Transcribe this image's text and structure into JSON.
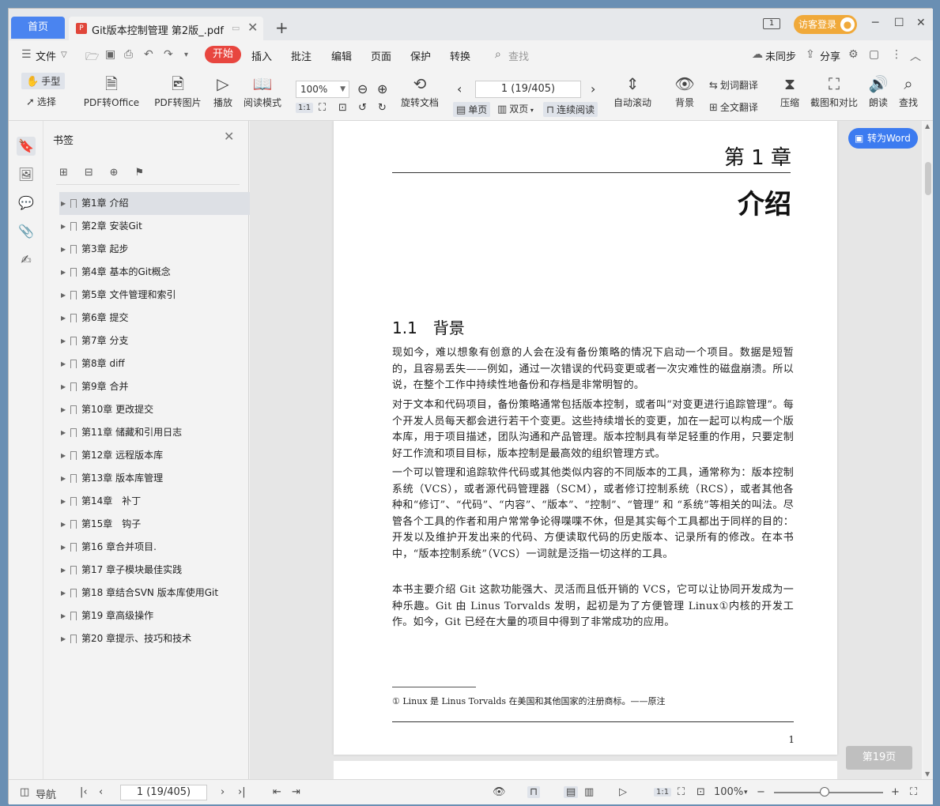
{
  "tabs": {
    "home": "首页",
    "doc_title": "Git版本控制管理 第2版_.pdf",
    "add": "+"
  },
  "titlebar": {
    "page_count_badge": "1",
    "login": "访客登录"
  },
  "menubar": {
    "file": "文件",
    "start": "开始",
    "insert": "插入",
    "annotate": "批注",
    "edit": "编辑",
    "page": "页面",
    "protect": "保护",
    "convert": "转换",
    "search_placeholder": "查找",
    "sync": "未同步",
    "share": "分享"
  },
  "ribbon": {
    "hand": "手型",
    "select": "选择",
    "pdf_to_office": "PDF转Office",
    "pdf_to_image": "PDF转图片",
    "play": "播放",
    "read_mode": "阅读模式",
    "zoom": "100%",
    "rotate_doc": "旋转文档",
    "page_indicator": "1 (19/405)",
    "single_page": "单页",
    "double_page": "双页",
    "continuous": "连续阅读",
    "auto_scroll": "自动滚动",
    "background": "背景",
    "word_translate": "划词翻译",
    "full_translate": "全文翻译",
    "compress": "压缩",
    "screenshot_compare": "截图和对比",
    "read_aloud": "朗读",
    "find": "查找"
  },
  "bookmarks": {
    "title": "书签",
    "items": [
      "第1章 介绍",
      "第2章 安装Git",
      "第3章 起步",
      "第4章 基本的Git概念",
      "第5章 文件管理和索引",
      "第6章 提交",
      "第7章 分支",
      "第8章 diff",
      "第9章 合并",
      "第10章 更改提交",
      "第11章 储藏和引用日志",
      "第12章 远程版本库",
      "第13章 版本库管理",
      "第14章　补丁",
      "第15章　钩子",
      "第16 章合并项目.",
      "第17 章子模块最佳实践",
      "第18 章结合SVN 版本库使用Git",
      "第19 章高级操作",
      "第20 章提示、技巧和技术"
    ]
  },
  "document": {
    "chapter_number": "第 1 章",
    "chapter_title": "介绍",
    "section_title": "1.1　背景",
    "paragraphs": [
      "现如今，难以想象有创意的人会在没有备份策略的情况下启动一个项目。数据是短暂的，且容易丢失——例如，通过一次错误的代码变更或者一次灾难性的磁盘崩溃。所以说，在整个工作中持续性地备份和存档是非常明智的。",
      "对于文本和代码项目，备份策略通常包括版本控制，或者叫“对变更进行追踪管理”。每个开发人员每天都会进行若干个变更。这些持续增长的变更，加在一起可以构成一个版本库，用于项目描述，团队沟通和产品管理。版本控制具有举足轻重的作用，只要定制好工作流和项目目标，版本控制是最高效的组织管理方式。",
      "一个可以管理和追踪软件代码或其他类似内容的不同版本的工具，通常称为：版本控制系统（VCS），或者源代码管理器（SCM），或者修订控制系统（RCS），或者其他各种和“修订”、“代码”、“内容”、“版本”、“控制”、“管理” 和 “系统”等相关的叫法。尽管各个工具的作者和用户常常争论得喋喋不休，但是其实每个工具都出于同样的目的：开发以及维护开发出来的代码、方便读取代码的历史版本、记录所有的修改。在本书中，“版本控制系统”（VCS）一词就是泛指一切这样的工具。",
      "本书主要介绍 Git 这款功能强大、灵活而且低开销的 VCS，它可以让协同开发成为一种乐趣。Git 由 Linus Torvalds 发明，起初是为了方便管理 Linux①内核的开发工作。如今，Git 已经在大量的项目中得到了非常成功的应用。"
    ],
    "footnote": "① Linux 是 Linus Torvalds 在美国和其他国家的注册商标。——原注",
    "page_number": "1"
  },
  "overlay": {
    "to_word": "转为Word",
    "page_tip": "第19页"
  },
  "statusbar": {
    "nav": "导航",
    "page_indicator": "1 (19/405)",
    "zoom": "100%"
  }
}
